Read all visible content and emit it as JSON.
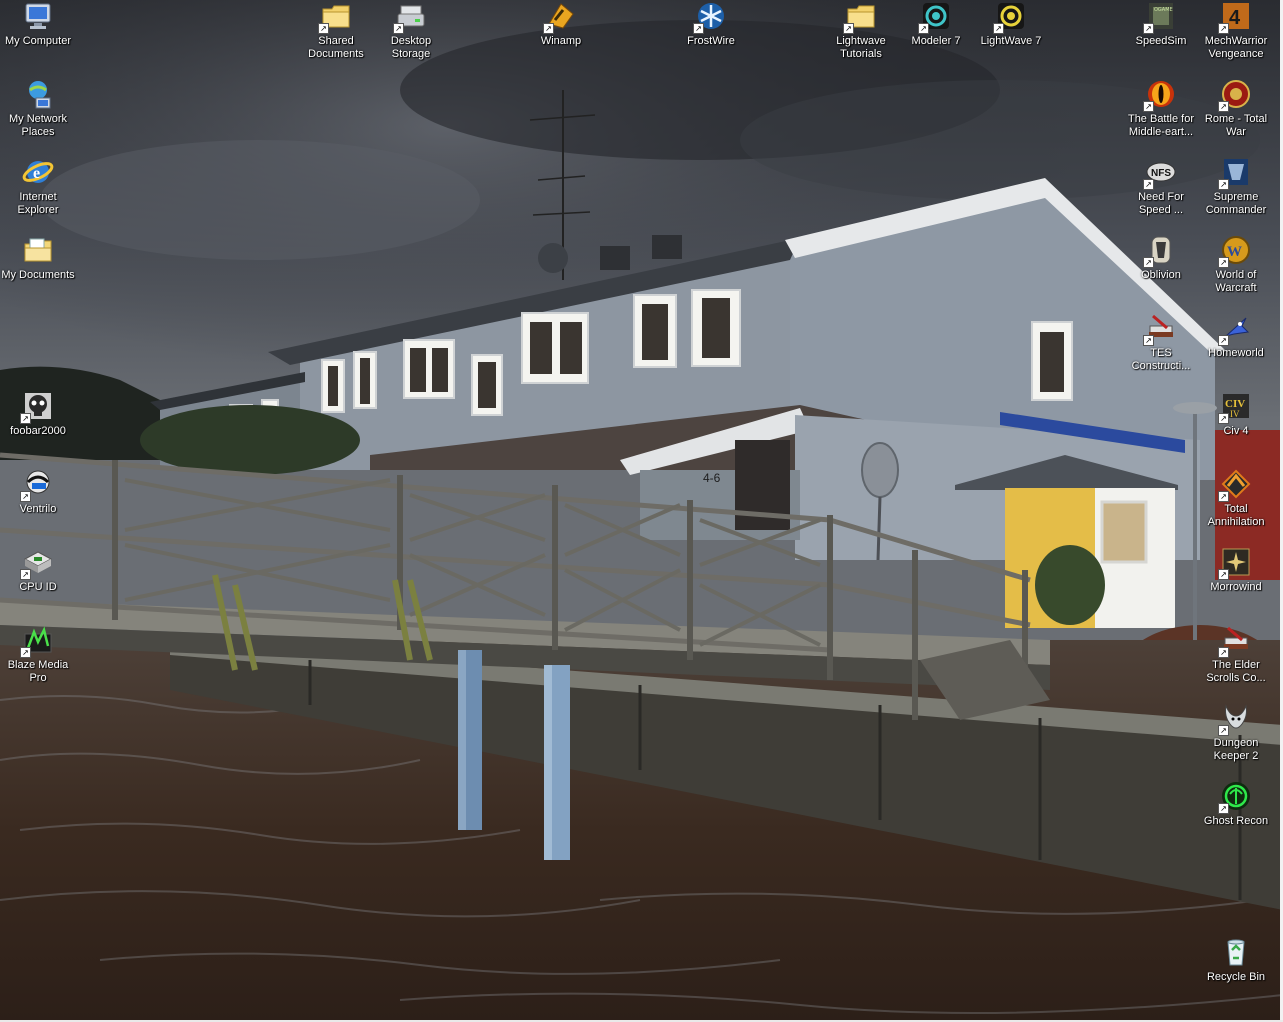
{
  "desktop": {
    "icons": [
      {
        "key": "my-computer",
        "label": "My Computer",
        "glyph": "monitor-icon",
        "shortcut": false
      },
      {
        "key": "my-network-places",
        "label": "My Network Places",
        "glyph": "network-icon",
        "shortcut": false
      },
      {
        "key": "internet-explorer",
        "label": "Internet Explorer",
        "glyph": "ie-icon",
        "shortcut": false
      },
      {
        "key": "my-documents",
        "label": "My Documents",
        "glyph": "documents-folder-icon",
        "shortcut": false
      },
      {
        "key": "foobar2000",
        "label": "foobar2000",
        "glyph": "skull-icon",
        "shortcut": true
      },
      {
        "key": "ventrilo",
        "label": "Ventrilo",
        "glyph": "headset-icon",
        "shortcut": true
      },
      {
        "key": "cpu-id",
        "label": "CPU ID",
        "glyph": "chip-icon",
        "shortcut": true
      },
      {
        "key": "blaze-media-pro",
        "label": "Blaze Media Pro",
        "glyph": "media-icon",
        "shortcut": true
      },
      {
        "key": "shared-documents",
        "label": "Shared Documents",
        "glyph": "folder-icon",
        "shortcut": true
      },
      {
        "key": "desktop-storage",
        "label": "Desktop Storage",
        "glyph": "drive-icon",
        "shortcut": true
      },
      {
        "key": "winamp",
        "label": "Winamp",
        "glyph": "winamp-icon",
        "shortcut": true
      },
      {
        "key": "frostwire",
        "label": "FrostWire",
        "glyph": "frostwire-icon",
        "shortcut": true
      },
      {
        "key": "lightwave-tutorials",
        "label": "Lightwave Tutorials",
        "glyph": "folder-icon",
        "shortcut": true
      },
      {
        "key": "modeler-7",
        "label": "Modeler 7",
        "glyph": "lightwave-modeler-icon",
        "shortcut": true
      },
      {
        "key": "lightwave-7",
        "label": "LightWave 7",
        "glyph": "lightwave-icon",
        "shortcut": true
      },
      {
        "key": "speedsim",
        "label": "SpeedSim",
        "glyph": "speedsim-icon",
        "shortcut": true
      },
      {
        "key": "mechwarrior-vengeance",
        "label": "MechWarrior Vengeance",
        "glyph": "mechwarrior-icon",
        "shortcut": true
      },
      {
        "key": "battle-for-middle-earth",
        "label": "The Battle for Middle-eart...",
        "glyph": "eye-icon",
        "shortcut": true
      },
      {
        "key": "rome-total-war",
        "label": "Rome - Total War",
        "glyph": "rome-icon",
        "shortcut": true
      },
      {
        "key": "need-for-speed",
        "label": "Need For Speed ...",
        "glyph": "nfs-icon",
        "shortcut": true
      },
      {
        "key": "supreme-commander",
        "label": "Supreme Commander",
        "glyph": "supcom-icon",
        "shortcut": true
      },
      {
        "key": "oblivion",
        "label": "Oblivion",
        "glyph": "oblivion-icon",
        "shortcut": true
      },
      {
        "key": "world-of-warcraft",
        "label": "World of Warcraft",
        "glyph": "wow-icon",
        "shortcut": true
      },
      {
        "key": "tes-construction-set",
        "label": "TES Constructi...",
        "glyph": "hammer-icon",
        "shortcut": true
      },
      {
        "key": "homeworld",
        "label": "Homeworld",
        "glyph": "ship-icon",
        "shortcut": true
      },
      {
        "key": "civ-4",
        "label": "Civ 4",
        "glyph": "civ-icon",
        "shortcut": true
      },
      {
        "key": "total-annihilation",
        "label": "Total Annihilation",
        "glyph": "ta-icon",
        "shortcut": true
      },
      {
        "key": "morrowind",
        "label": "Morrowind",
        "glyph": "morrowind-icon",
        "shortcut": true
      },
      {
        "key": "elder-scrolls-construction",
        "label": "The Elder Scrolls Co...",
        "glyph": "hammer-icon",
        "shortcut": true
      },
      {
        "key": "dungeon-keeper-2",
        "label": "Dungeon Keeper 2",
        "glyph": "horned-icon",
        "shortcut": true
      },
      {
        "key": "ghost-recon",
        "label": "Ghost Recon",
        "glyph": "ghost-recon-icon",
        "shortcut": true
      },
      {
        "key": "recycle-bin",
        "label": "Recycle Bin",
        "glyph": "recycle-bin-icon",
        "shortcut": false
      }
    ],
    "wallpaper": {
      "wall_text": "4-6",
      "colors": {
        "sky": "#3b3f46",
        "house": "#8e97a3",
        "water": "#3a2c22",
        "yellow_house": "#e8c24a"
      }
    }
  }
}
